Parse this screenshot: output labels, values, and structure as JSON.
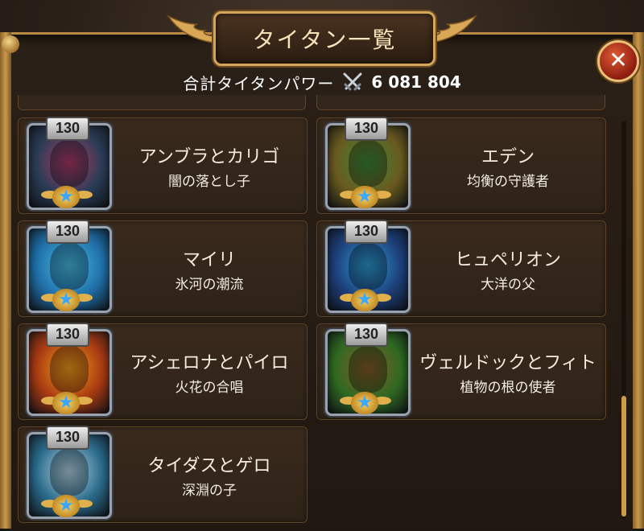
{
  "window": {
    "title": "タイタン一覧",
    "close_symbol": "✕"
  },
  "summary": {
    "power_label": "合計タイタンパワー",
    "power_icon": "crossed-swords-icon",
    "power_value": "6 081 804"
  },
  "colors": {
    "frame_gold": "#c99a4c",
    "star_blue": "#3aa8ff",
    "close_red": "#c8391e"
  },
  "titans": [
    {
      "level": "130",
      "name": "アンブラとカリゴ",
      "subtitle": "闇の落とし子",
      "color": "#2a3c55",
      "accent": "#b33a6a",
      "star": "★"
    },
    {
      "level": "130",
      "name": "エデン",
      "subtitle": "均衡の守護者",
      "color": "#6a5a1f",
      "accent": "#3b8a3a",
      "star": "★"
    },
    {
      "level": "130",
      "name": "マイリ",
      "subtitle": "氷河の潮流",
      "color": "#1f6fa8",
      "accent": "#4ac0e8",
      "star": "★"
    },
    {
      "level": "130",
      "name": "ヒュペリオン",
      "subtitle": "大洋の父",
      "color": "#1d3f7a",
      "accent": "#2ea0d8",
      "star": "★"
    },
    {
      "level": "130",
      "name": "アシェロナとパイロ",
      "subtitle": "火花の合唱",
      "color": "#a83a12",
      "accent": "#f2a21c",
      "star": "★"
    },
    {
      "level": "130",
      "name": "ヴェルドックとフィト",
      "subtitle": "植物の根の使者",
      "color": "#2f6a22",
      "accent": "#8a5a28",
      "star": "★"
    },
    {
      "level": "130",
      "name": "タイダスとゲロ",
      "subtitle": "深淵の子",
      "color": "#2a6a8a",
      "accent": "#b8d8e8",
      "star": "★"
    }
  ]
}
